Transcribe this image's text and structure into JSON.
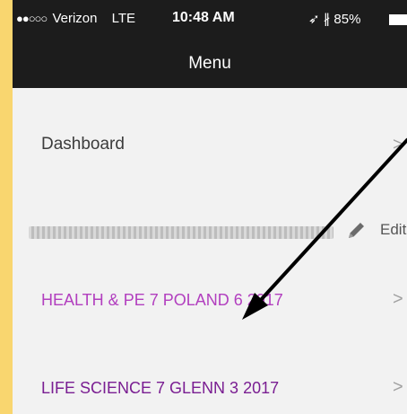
{
  "status_bar": {
    "carrier": "Verizon",
    "network": "LTE",
    "time": "10:48 AM",
    "battery": "85%",
    "icons": [
      "signal-dots-icon",
      "location-arrow-icon",
      "bluetooth-icon",
      "battery-icon"
    ]
  },
  "nav": {
    "title": "Menu"
  },
  "menu": {
    "dashboard_label": "Dashboard",
    "edit_label": "Edit",
    "courses": [
      {
        "label": "HEALTH & PE 7 POLAND 6 2017"
      },
      {
        "label": "LIFE SCIENCE 7 GLENN 3 2017"
      }
    ]
  },
  "colors": {
    "background": "#f9d66f",
    "bar": "#1c1c1c",
    "course_link": "#b23fbf",
    "course_link_dark": "#7a1e92"
  }
}
